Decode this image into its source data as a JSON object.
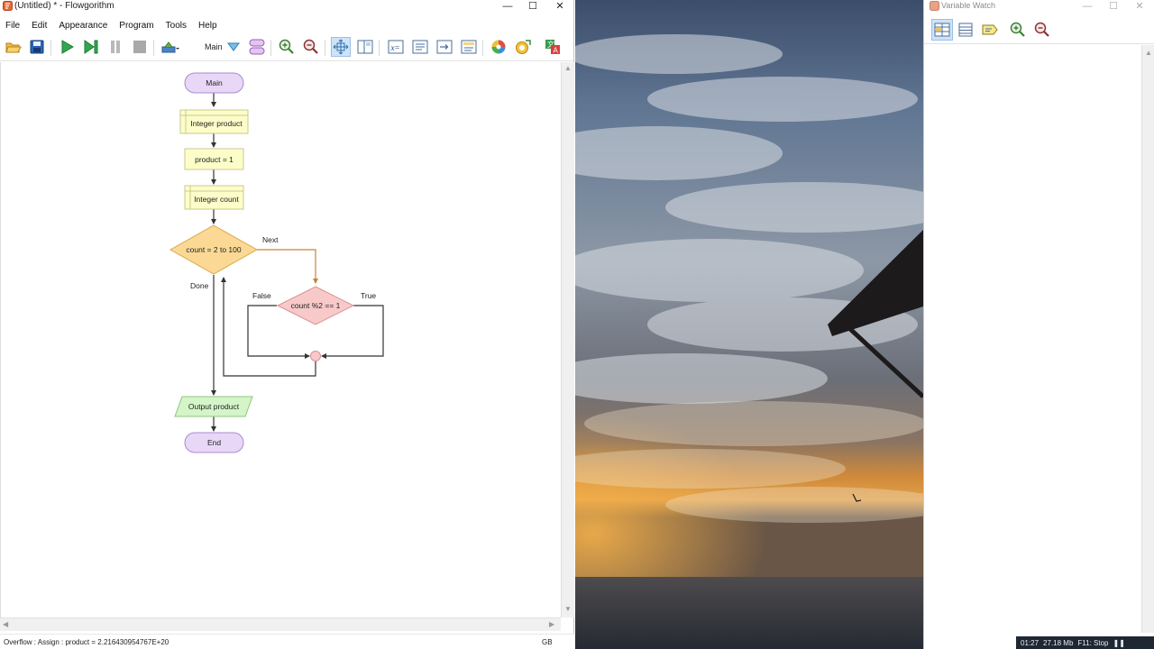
{
  "main_window": {
    "title": "(Untitled) * - Flowgorithm",
    "window_controls": {
      "minimize": "—",
      "maximize": "☐",
      "close": "✕"
    },
    "menu": [
      "File",
      "Edit",
      "Appearance",
      "Program",
      "Tools",
      "Help"
    ],
    "toolbar": {
      "function_selector": "Main",
      "icons": [
        "open-icon",
        "save-icon",
        "run-icon",
        "step-icon",
        "pause-icon",
        "stop-icon",
        "speed-icon",
        "function-dropdown-icon",
        "manage-functions-icon",
        "zoom-in-icon",
        "zoom-out-icon",
        "layout-icon",
        "split-view-icon",
        "variable-watch-icon",
        "console-icon",
        "source-view-icon",
        "chart-view-icon",
        "color-icon",
        "style-icon",
        "language-icon"
      ]
    },
    "flowchart": {
      "start": "Main",
      "declare1": "Integer product",
      "assign1": "product = 1",
      "declare2": "Integer count",
      "for_loop": "count = 2 to 100",
      "for_next": "Next",
      "for_done": "Done",
      "if_cond": "count %2 == 1",
      "if_false": "False",
      "if_true": "True",
      "output": "Output product",
      "end": "End"
    },
    "status": {
      "message": "Overflow : Assign : product = 2.216430954767E+20",
      "language": "GB"
    },
    "colors": {
      "terminal_fill": "#e8d7f7",
      "terminal_stroke": "#a98bd0",
      "declare_fill": "#fdfdca",
      "declare_stroke": "#c9c98f",
      "loop_fill": "#fbd995",
      "loop_stroke": "#d8a94a",
      "if_fill": "#f8c9c9",
      "if_stroke": "#d99191",
      "output_fill": "#d3f5c8",
      "output_stroke": "#8fc67c"
    }
  },
  "photo": {
    "description_icon": "sunset-photo"
  },
  "variable_watch": {
    "title": "Variable Watch",
    "window_controls": {
      "minimize": "—",
      "maximize": "☐",
      "close": "✕"
    },
    "toolbar_icons": [
      "watch-table-icon",
      "list-icon",
      "tag-icon",
      "zoom-in-icon",
      "zoom-out-icon"
    ]
  },
  "tray": {
    "time": "01:27",
    "memory": "27.18 Mb",
    "hint": "F11: Stop",
    "pause": "❚❚"
  }
}
